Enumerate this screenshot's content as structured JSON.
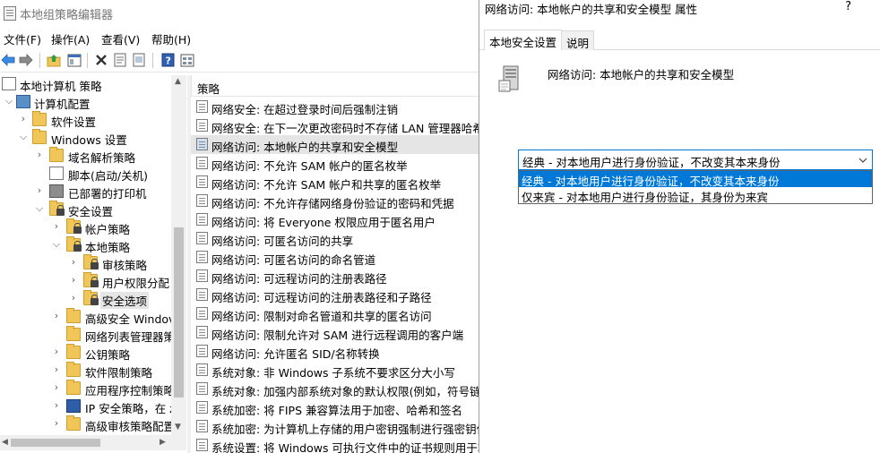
{
  "main_window": {
    "title": "本地组策略编辑器",
    "menu": [
      "文件(F)",
      "操作(A)",
      "查看(V)",
      "帮助(H)"
    ],
    "toolbar_icons": [
      "back-arrow-icon",
      "forward-arrow-icon",
      "up-folder-icon",
      "show-tree-icon",
      "delete-icon",
      "properties-icon",
      "export-icon",
      "help-icon",
      "view-icon"
    ]
  },
  "tree": {
    "items": [
      {
        "label": "本地计算机 策略",
        "icon": "computer-policy-icon"
      },
      {
        "label": "计算机配置",
        "icon": "computer-icon"
      },
      {
        "label": "软件设置",
        "icon": "folder-icon"
      },
      {
        "label": "Windows 设置",
        "icon": "folder-icon"
      },
      {
        "label": "域名解析策略",
        "icon": "folder-icon"
      },
      {
        "label": "脚本(启动/关机)",
        "icon": "script-icon"
      },
      {
        "label": "已部署的打印机",
        "icon": "printer-icon"
      },
      {
        "label": "安全设置",
        "icon": "security-folder-icon"
      },
      {
        "label": "帐户策略",
        "icon": "lock-folder-icon"
      },
      {
        "label": "本地策略",
        "icon": "lock-folder-icon"
      },
      {
        "label": "审核策略",
        "icon": "lock-folder-icon"
      },
      {
        "label": "用户权限分配",
        "icon": "lock-folder-icon"
      },
      {
        "label": "安全选项",
        "icon": "lock-folder-icon"
      },
      {
        "label": "高级安全 Windov",
        "icon": "folder-icon"
      },
      {
        "label": "网络列表管理器策",
        "icon": "folder-icon"
      },
      {
        "label": "公钥策略",
        "icon": "folder-icon"
      },
      {
        "label": "软件限制策略",
        "icon": "folder-icon"
      },
      {
        "label": "应用程序控制策略",
        "icon": "folder-icon"
      },
      {
        "label": "IP 安全策略，在 z",
        "icon": "ipsec-icon"
      },
      {
        "label": "高级审核策略配置",
        "icon": "folder-icon"
      }
    ]
  },
  "list": {
    "column_header": "策略",
    "rows": [
      "网络安全: 在超过登录时间后强制注销",
      "网络安全: 在下一次更改密码时不存储 LAN 管理器哈希值",
      "网络访问: 本地帐户的共享和安全模型",
      "网络访问: 不允许 SAM 帐户的匿名枚举",
      "网络访问: 不允许 SAM 帐户和共享的匿名枚举",
      "网络访问: 不允许存储网络身份验证的密码和凭据",
      "网络访问: 将 Everyone 权限应用于匿名用户",
      "网络访问: 可匿名访问的共享",
      "网络访问: 可匿名访问的命名管道",
      "网络访问: 可远程访问的注册表路径",
      "网络访问: 可远程访问的注册表路径和子路径",
      "网络访问: 限制对命名管道和共享的匿名访问",
      "网络访问: 限制允许对 SAM 进行远程调用的客户端",
      "网络访问: 允许匿名 SID/名称转换",
      "系统对象: 非 Windows 子系统不要求区分大小写",
      "系统对象: 加强内部系统对象的默认权限(例如，符号链接)",
      "系统加密: 将 FIPS 兼容算法用于加密、哈希和签名",
      "系统加密: 为计算机上存储的用户密钥强制进行强密钥保护",
      "系统设置: 将 Windows 可执行文件中的证书规则用于软件"
    ]
  },
  "dialog": {
    "title": "网络访问: 本地帐户的共享和安全模型 属性",
    "help_label": "?",
    "tabs": [
      "本地安全设置",
      "说明"
    ],
    "policy_name": "网络访问: 本地帐户的共享和安全模型",
    "combo_value": "经典 - 对本地用户进行身份验证，不改变其本来身份",
    "options": [
      "经典 - 对本地用户进行身份验证，不改变其本来身份",
      "仅来宾 - 对本地用户进行身份验证，其身份为来宾"
    ]
  },
  "colors": {
    "selection_blue": "#0078d7",
    "folder_yellow": "#f0c659",
    "row_highlight": "#e5e5e5"
  }
}
